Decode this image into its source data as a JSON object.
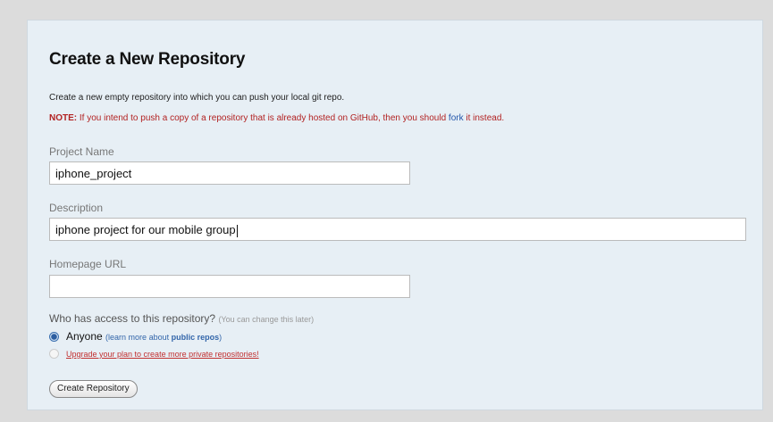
{
  "form": {
    "title": "Create a New Repository",
    "intro": "Create a new empty repository into which you can push your local git repo.",
    "note_prefix": "NOTE:",
    "note_text_before": " If you intend to push a copy of a repository that is already hosted on GitHub, then you should ",
    "note_link": "fork",
    "note_text_after": " it instead.",
    "project_name_label": "Project Name",
    "project_name_value": "iphone_project",
    "description_label": "Description",
    "description_value": "iphone project for our mobile group",
    "homepage_label": "Homepage URL",
    "homepage_value": "",
    "access_question": "Who has access to this repository?",
    "access_hint": "(You can change this later)",
    "option_anyone_label": "Anyone",
    "option_anyone_hint_before": "(learn more about ",
    "option_anyone_hint_link": "public repos",
    "option_anyone_hint_after": ")",
    "option_private_label": "Upgrade your plan to create more private repositories!",
    "submit_label": "Create Repository"
  },
  "colors": {
    "background": "#dcdcdc",
    "panel": "#e7eff5",
    "note": "#b22222",
    "link": "#2255aa"
  }
}
